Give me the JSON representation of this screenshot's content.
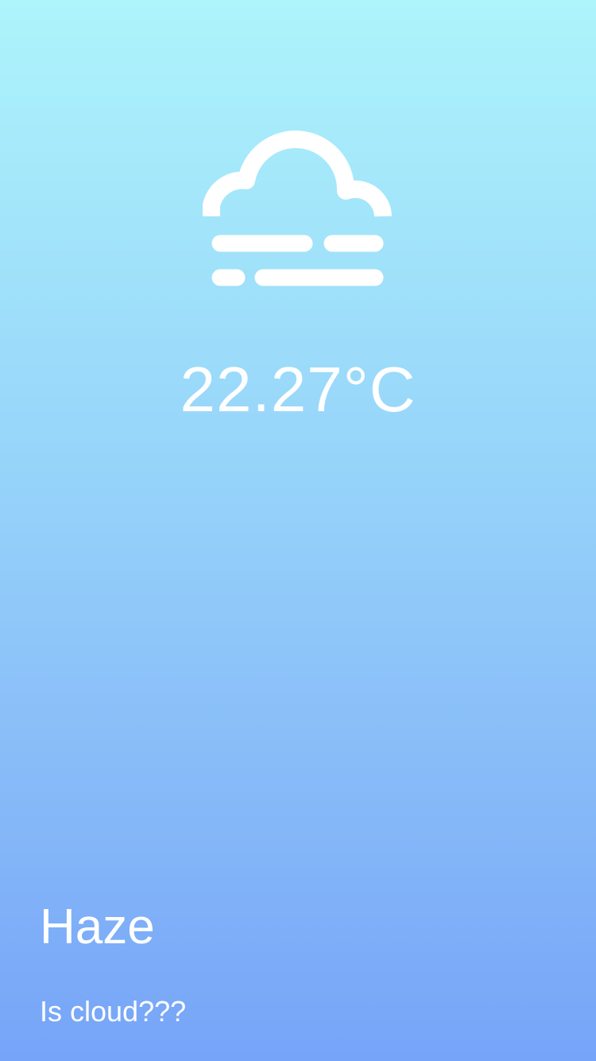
{
  "weather": {
    "icon": "haze-icon",
    "temperature": "22.27°C",
    "condition": "Haze",
    "description": "Is cloud???"
  },
  "theme": {
    "gradient_top": "#adf4fb",
    "gradient_bottom": "#76a4f8",
    "text_color": "#ffffff"
  }
}
